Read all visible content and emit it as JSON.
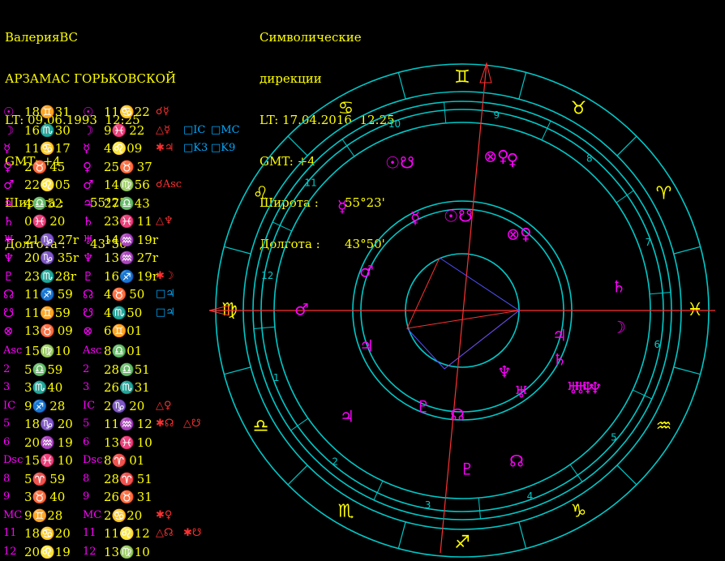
{
  "natal_header": {
    "name": "ВалерияВС",
    "place": "АРЗАМАС ГОРЬКОВСКОЙ",
    "lt": "LT: 09.06.1993  12:25",
    "gmt": "GMT: +4",
    "lat_label": "Широта :",
    "lat_value": "55°23'",
    "lon_label": "Долгота :",
    "lon_value": "43°50'"
  },
  "prog_header": {
    "title1": "Символические",
    "title2": "дирекции",
    "lt": "LT: 17.04.2016  12:25",
    "gmt": "GMT: +4",
    "lat_label": "Широта :",
    "lat_value": "55°23'",
    "lon_label": "Долгота :",
    "lon_value": "43°50'"
  },
  "planets": [
    {
      "glyph": "☉",
      "natal": "18♊31",
      "prog": "11♋22",
      "asp": [
        {
          "t": "☌☿",
          "c": "#ff3030"
        }
      ]
    },
    {
      "glyph": "☽",
      "natal": "16♏30",
      "prog": "9♓ 22",
      "asp": [
        {
          "t": "△☿",
          "c": "#ff3030"
        },
        {
          "t": "□IC",
          "c": "#00aaff"
        },
        {
          "t": "□MC",
          "c": "#00aaff"
        }
      ]
    },
    {
      "glyph": "☿",
      "natal": "11♋17",
      "prog": "4♌09",
      "asp": [
        {
          "t": "✱♃",
          "c": "#ff3030"
        },
        {
          "t": "□K3",
          "c": "#00aaff"
        },
        {
          "t": "□K9",
          "c": "#00aaff"
        }
      ]
    },
    {
      "glyph": "♀",
      "natal": "2♉ 45",
      "prog": "25♉ 37",
      "asp": []
    },
    {
      "glyph": "♂",
      "natal": "22♌05",
      "prog": "14♍56",
      "asp": [
        {
          "t": "☌Asc",
          "c": "#ff3030"
        }
      ]
    },
    {
      "glyph": "♃",
      "natal": "4♎52",
      "prog": "27♎43",
      "asp": []
    },
    {
      "glyph": "♄",
      "natal": "0♓ 20",
      "prog": "23♓ 11",
      "asp": [
        {
          "t": "△♆",
          "c": "#ff3030"
        }
      ]
    },
    {
      "glyph": "♅",
      "natal": "21♑ 27r",
      "prog": "14♒ 19r",
      "asp": []
    },
    {
      "glyph": "♆",
      "natal": "20♑ 35r",
      "prog": "13♒ 27r",
      "asp": []
    },
    {
      "glyph": "♇",
      "natal": "23♏28r",
      "prog": "16♐ 19r",
      "asp": [
        {
          "t": "✱☽",
          "c": "#ff3030"
        }
      ]
    },
    {
      "glyph": "☊",
      "natal": "11♐ 59",
      "prog": "4♉ 50",
      "asp": [
        {
          "t": "□♃",
          "c": "#00aaff"
        }
      ]
    },
    {
      "glyph": "☋",
      "natal": "11♊59",
      "prog": "4♏50",
      "asp": [
        {
          "t": "□♃",
          "c": "#00aaff"
        }
      ]
    },
    {
      "glyph": "⊗",
      "natal": "13♉ 09",
      "prog": "6♊01",
      "asp": []
    }
  ],
  "houses": [
    {
      "label": "Asc",
      "natal": "15♍10",
      "prog": "8♎01",
      "asp": []
    },
    {
      "label": "2",
      "natal": "5♎59",
      "prog": "28♎51",
      "asp": []
    },
    {
      "label": "3",
      "natal": "3♏40",
      "prog": "26♏31",
      "asp": []
    },
    {
      "label": "IC",
      "natal": "9♐ 28",
      "prog": "2♑ 20",
      "asp": [
        {
          "t": "△♀",
          "c": "#ff3030"
        }
      ]
    },
    {
      "label": "5",
      "natal": "18♑ 20",
      "prog": "11♒ 12",
      "asp": [
        {
          "t": "✱☊",
          "c": "#ff3030"
        },
        {
          "t": "△☋",
          "c": "#ff3030"
        }
      ]
    },
    {
      "label": "6",
      "natal": "20♒ 19",
      "prog": "13♓ 10",
      "asp": []
    },
    {
      "label": "Dsc",
      "natal": "15♓ 10",
      "prog": "8♈ 01",
      "asp": []
    },
    {
      "label": "8",
      "natal": "5♈ 59",
      "prog": "28♈ 51",
      "asp": []
    },
    {
      "label": "9",
      "natal": "3♉ 40",
      "prog": "26♉ 31",
      "asp": []
    },
    {
      "label": "MC",
      "natal": "9♊28",
      "prog": "2♋20",
      "asp": [
        {
          "t": "✱♀",
          "c": "#ff3030"
        }
      ]
    },
    {
      "label": "11",
      "natal": "18♋20",
      "prog": "11♌12",
      "asp": [
        {
          "t": "△☊",
          "c": "#ff3030"
        },
        {
          "t": "✱☋",
          "c": "#ff3030"
        }
      ]
    },
    {
      "label": "12",
      "natal": "20♌19",
      "prog": "13♍10",
      "asp": []
    }
  ],
  "wheel": {
    "sign_glyphs": [
      "♊",
      "♉",
      "♈",
      "♓",
      "♒",
      "♑",
      "♐",
      "♏",
      "♎",
      "♍",
      "♌",
      "♋"
    ],
    "house_numbers": [
      "1",
      "2",
      "3",
      "4",
      "5",
      "6",
      "7",
      "8",
      "9",
      "10",
      "11",
      "12"
    ],
    "outer_planets": [
      "⊗♀",
      "☉☋",
      "☿",
      "♄",
      "☽",
      "♅♆",
      "♂",
      "♃",
      "♇",
      "☊",
      "♀"
    ],
    "inner_planets": [
      "☉☋",
      "☿",
      "⊗♀",
      "♂",
      "♃",
      "♄",
      "☽",
      "♆",
      "♅",
      "♅♆",
      "♇",
      "☊",
      "♅",
      "♃"
    ],
    "colors": {
      "ring": "#00c8c8",
      "glyph": "#ffff00",
      "planet": "#ff00ff",
      "axis": "#ff3030",
      "aspect_blue": "#5050ff"
    }
  }
}
